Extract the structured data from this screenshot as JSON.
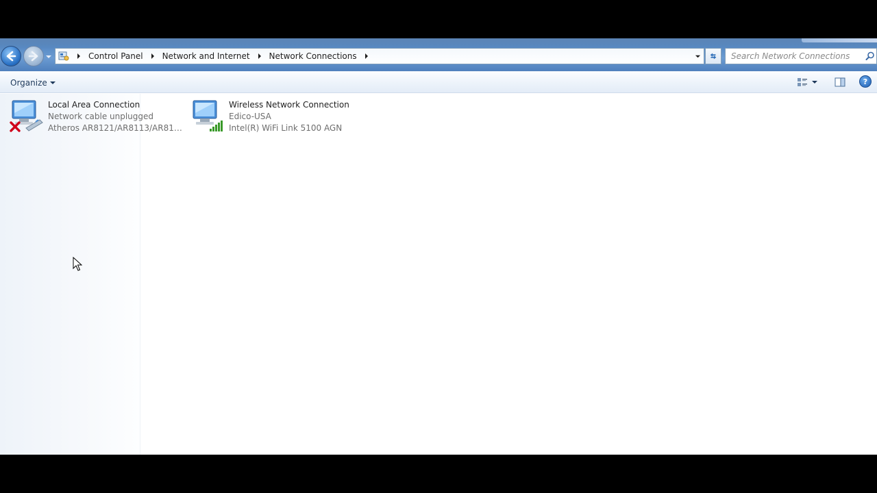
{
  "window": {
    "breadcrumbs": [
      "Control Panel",
      "Network and Internet",
      "Network Connections"
    ],
    "search_placeholder": "Search Network Connections"
  },
  "toolbar": {
    "organize_label": "Organize"
  },
  "connections": [
    {
      "name": "Local Area Connection",
      "status": "Network cable unplugged",
      "device": "Atheros AR8121/AR8113/AR8114 ...",
      "icon": "wired-network-disconnected-icon"
    },
    {
      "name": "Wireless Network Connection",
      "status": "Edico-USA",
      "device": "Intel(R) WiFi Link 5100 AGN",
      "icon": "wireless-network-icon"
    }
  ],
  "colors": {
    "aero_blue": "#5d8fc8",
    "link_text": "#1e395b",
    "secondary_text": "#6d6d6d",
    "error_red": "#d0021b",
    "signal_green": "#3a9a2a"
  }
}
